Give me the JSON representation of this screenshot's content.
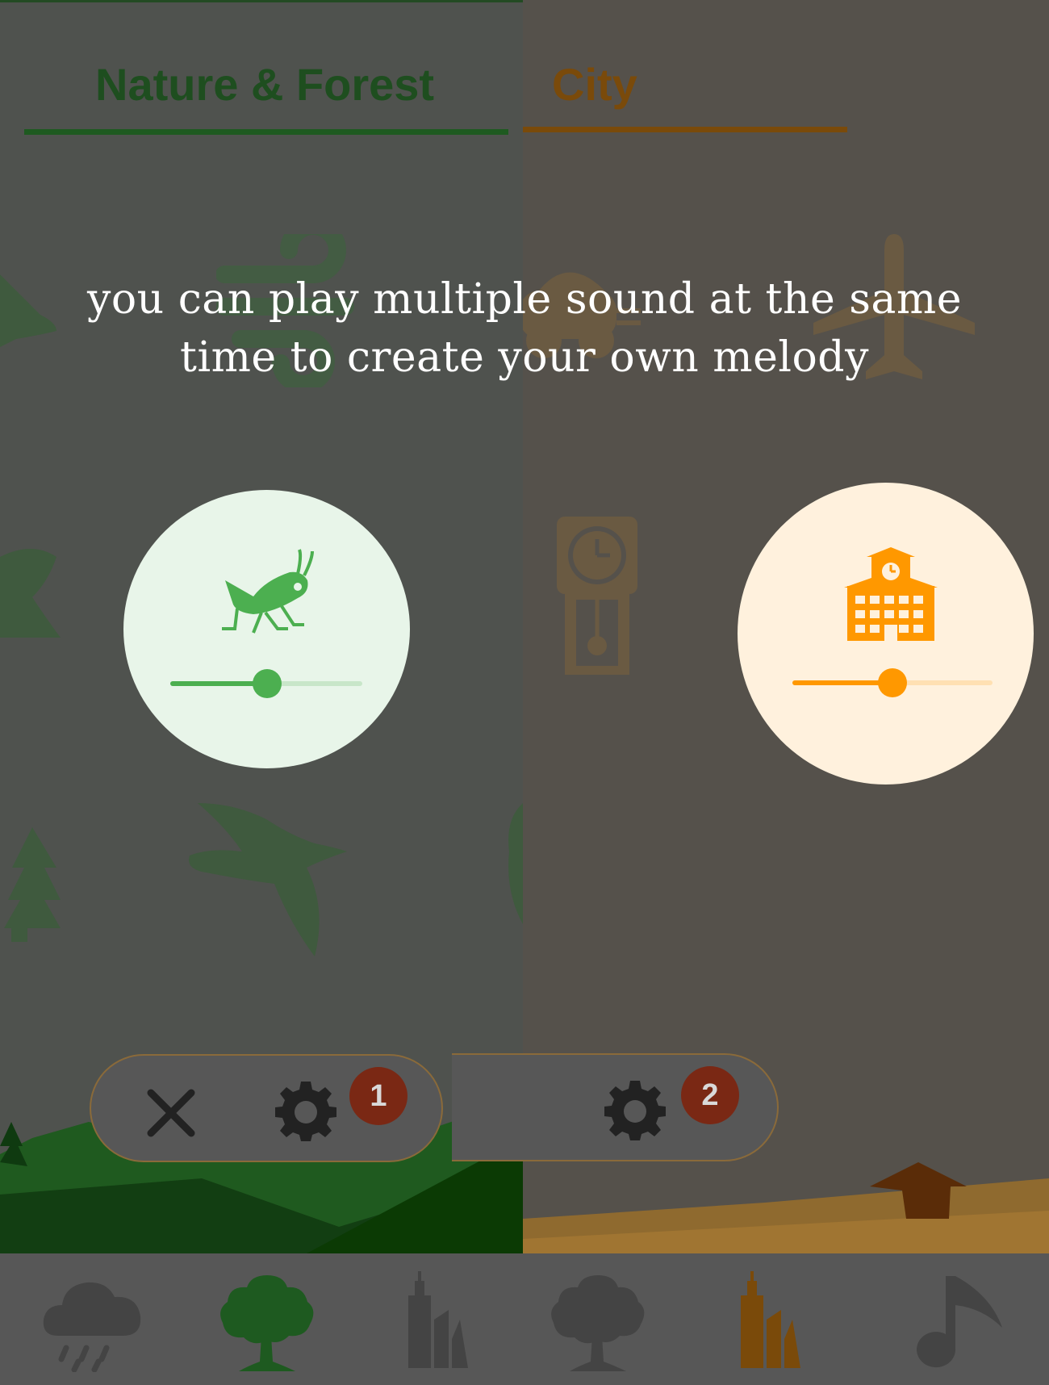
{
  "tabs": {
    "nature": {
      "label": "Nature & Forest",
      "color": "#1e4e1f"
    },
    "city": {
      "label": "City",
      "color": "#7a4a0a"
    }
  },
  "overlay": {
    "line1": "you can play multiple sound at the same",
    "line2": "time to create your own melody"
  },
  "active_sounds": {
    "nature": {
      "icon": "grasshopper-icon",
      "volume": 0.5,
      "accent": "#4caf50",
      "bg": "#e8f5e9"
    },
    "city": {
      "icon": "school-building-icon",
      "volume": 0.5,
      "accent": "#ff9800",
      "bg": "#fff3e0"
    }
  },
  "controls": {
    "nature": {
      "badge": "1"
    },
    "city": {
      "badge": "2"
    }
  },
  "bottom_nav": [
    {
      "icon": "rain-cloud-icon"
    },
    {
      "icon": "tree-icon",
      "active": true
    },
    {
      "icon": "city-buildings-icon"
    },
    {
      "icon": "tree-icon"
    },
    {
      "icon": "city-buildings-icon",
      "active": true
    },
    {
      "icon": "music-note-icon"
    }
  ]
}
